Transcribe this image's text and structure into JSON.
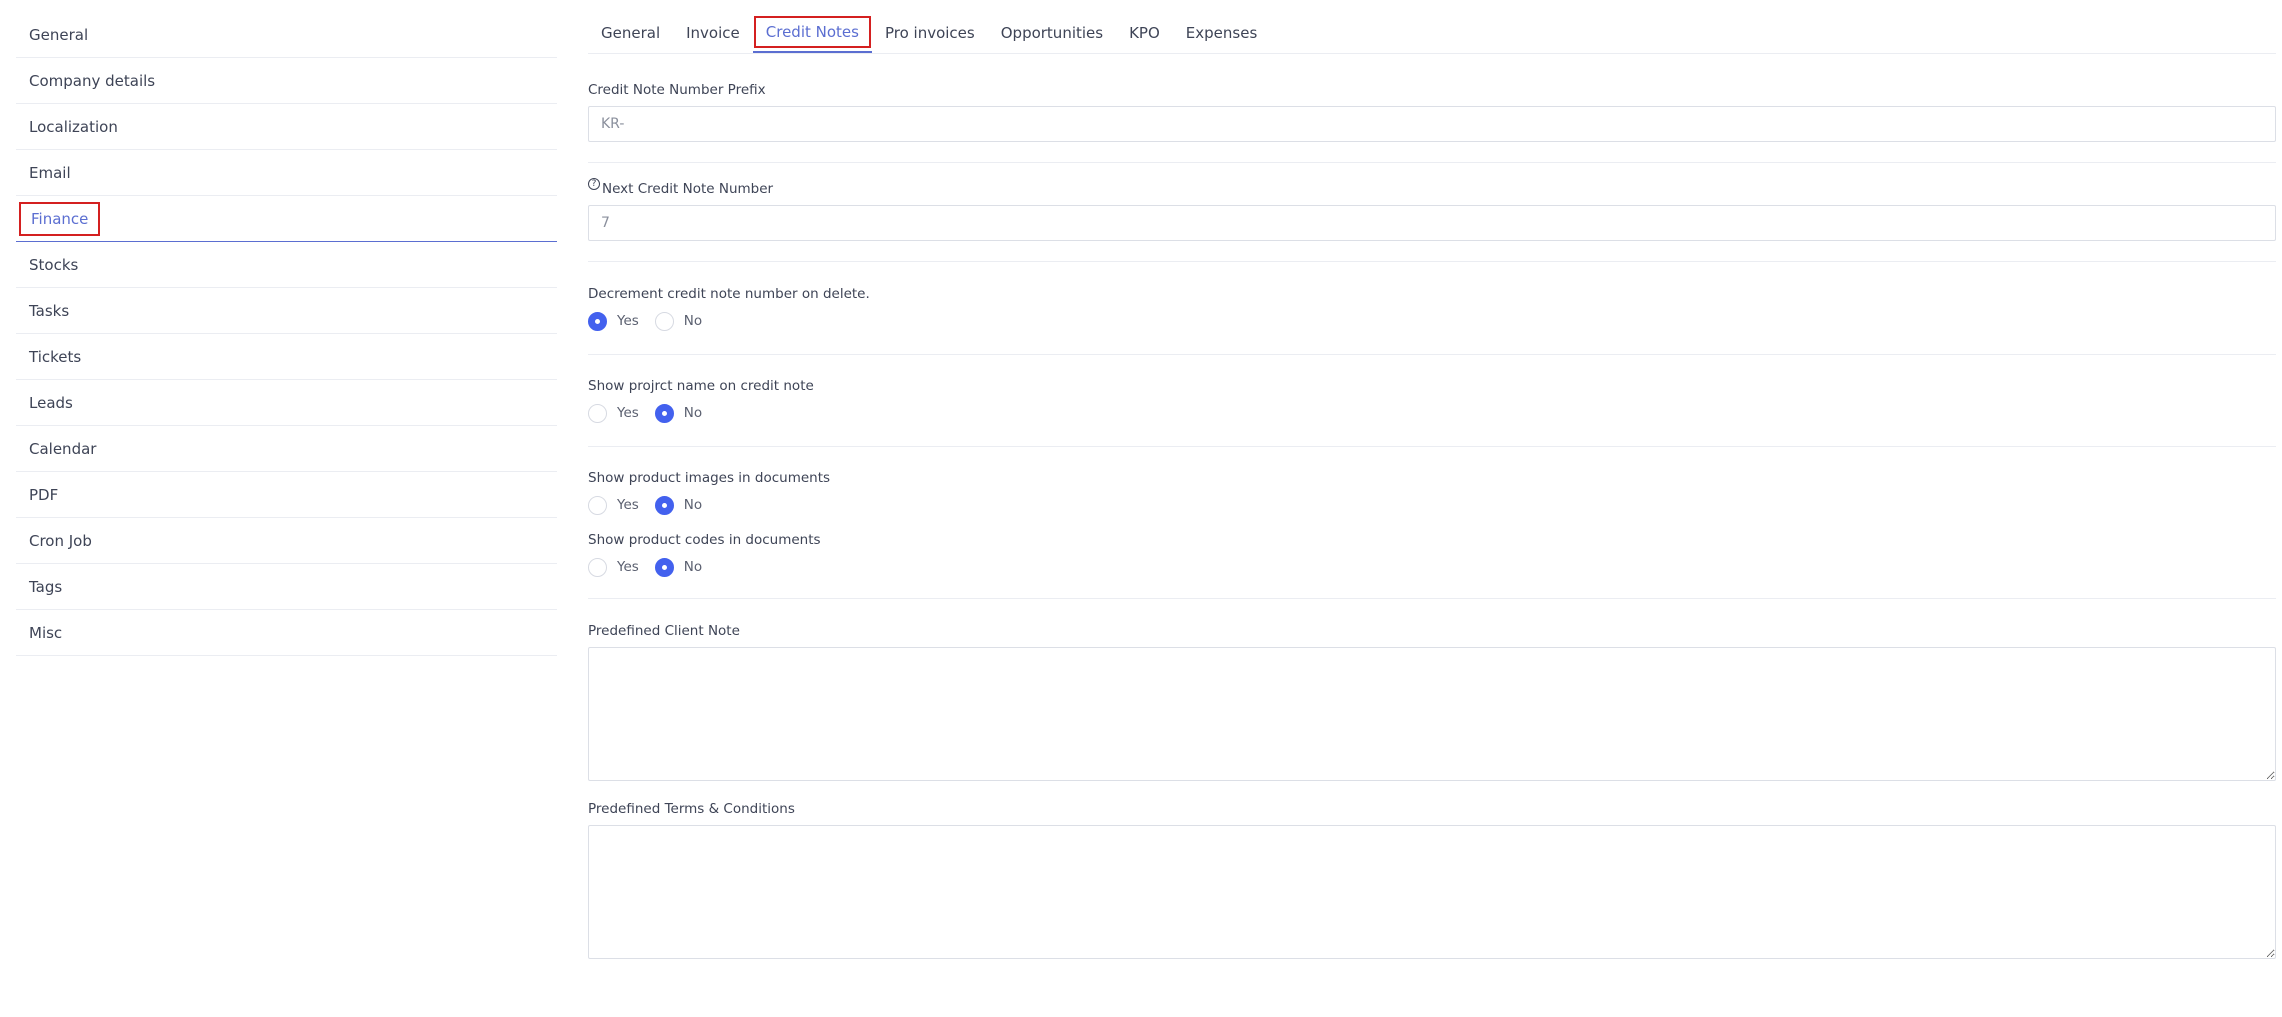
{
  "sidebar": {
    "items": [
      {
        "label": "General"
      },
      {
        "label": "Company details"
      },
      {
        "label": "Localization"
      },
      {
        "label": "Email"
      },
      {
        "label": "Finance"
      },
      {
        "label": "Stocks"
      },
      {
        "label": "Tasks"
      },
      {
        "label": "Tickets"
      },
      {
        "label": "Leads"
      },
      {
        "label": "Calendar"
      },
      {
        "label": "PDF"
      },
      {
        "label": "Cron Job"
      },
      {
        "label": "Tags"
      },
      {
        "label": "Misc"
      }
    ],
    "active": "Finance"
  },
  "tabs": {
    "items": [
      {
        "label": "General"
      },
      {
        "label": "Invoice"
      },
      {
        "label": "Credit Notes"
      },
      {
        "label": "Pro invoices"
      },
      {
        "label": "Opportunities"
      },
      {
        "label": "KPO"
      },
      {
        "label": "Expenses"
      }
    ],
    "active": "Credit Notes"
  },
  "form": {
    "prefix": {
      "label": "Credit Note Number Prefix",
      "value": "KR-"
    },
    "next_number": {
      "label": "Next Credit Note Number",
      "value": "7",
      "help_icon": "question-circle-icon"
    },
    "decrement": {
      "label": "Decrement credit note number on delete.",
      "yes": "Yes",
      "no": "No",
      "selected": "yes"
    },
    "show_project": {
      "label": "Show projrct name on credit note",
      "yes": "Yes",
      "no": "No",
      "selected": "no"
    },
    "show_images": {
      "label": "Show product images in documents",
      "yes": "Yes",
      "no": "No",
      "selected": "no"
    },
    "show_codes": {
      "label": "Show product codes in documents",
      "yes": "Yes",
      "no": "No",
      "selected": "no"
    },
    "client_note": {
      "label": "Predefined Client Note",
      "value": ""
    },
    "terms": {
      "label": "Predefined Terms & Conditions",
      "value": ""
    }
  },
  "colors": {
    "accent": "#4361ee",
    "active_text": "#5b6ed1",
    "highlight_box": "#d42020",
    "divider": "#ebedf2"
  }
}
